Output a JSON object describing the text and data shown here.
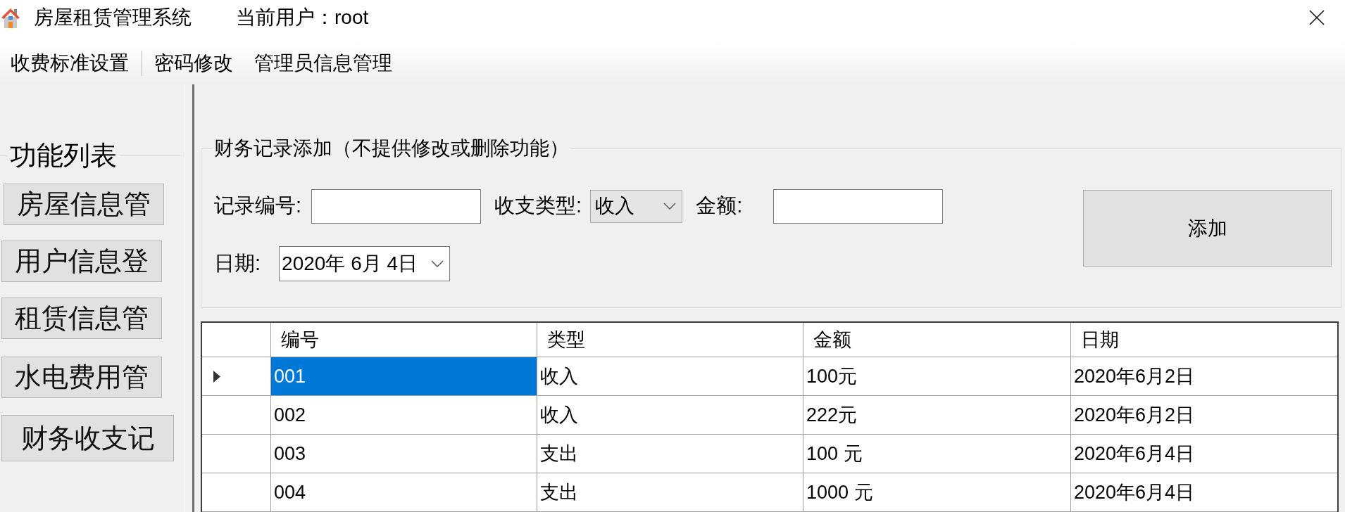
{
  "window": {
    "title": "房屋租赁管理系统",
    "user": "当前用户：root"
  },
  "menu": [
    {
      "kind": "item",
      "label": "收费标准设置"
    },
    {
      "kind": "separator"
    },
    {
      "kind": "item",
      "label": "密码修改"
    },
    {
      "kind": "item",
      "label": "管理员信息管理"
    }
  ],
  "sidebar": {
    "title": "功能列表",
    "buttons": [
      "房屋信息管",
      "用户信息登",
      "租赁信息管",
      "水电费用管",
      "财务收支记"
    ]
  },
  "form": {
    "title": "财务记录添加（不提供修改或删除功能）",
    "rows": [
      {
        "fields": [
          {
            "kind": "text",
            "label": "记录编号:"
          },
          {
            "kind": "dropdown",
            "label": "收支类型:",
            "value": "收入"
          },
          {
            "kind": "text",
            "label": "金额:"
          }
        ]
      },
      {
        "fields": [
          {
            "kind": "date",
            "label": "日期:",
            "value": "2020年 6月 4日"
          }
        ]
      }
    ],
    "add_button": "添加"
  },
  "table": {
    "columns": [
      "编号",
      "类型",
      "金额",
      "日期"
    ],
    "rows": [
      {
        "selected": true,
        "cells": [
          "001",
          "收入",
          "100元",
          "2020年6月2日"
        ]
      },
      {
        "selected": false,
        "cells": [
          "002",
          "收入",
          "222元",
          "2020年6月2日"
        ]
      },
      {
        "selected": false,
        "cells": [
          "003",
          "支出",
          "100 元",
          "2020年6月4日"
        ]
      },
      {
        "selected": false,
        "cells": [
          "004",
          "支出",
          "1000 元",
          "2020年6月4日"
        ]
      }
    ]
  }
}
